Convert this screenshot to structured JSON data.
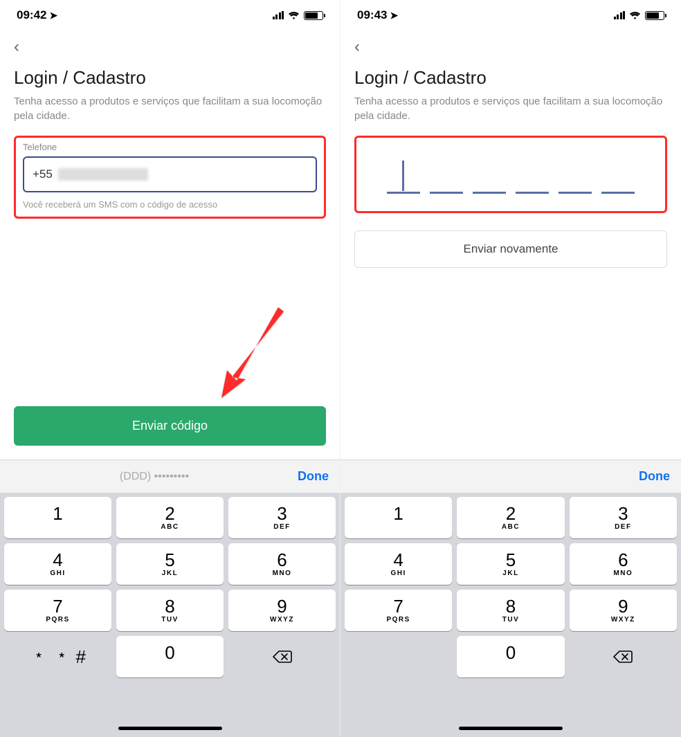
{
  "left": {
    "status": {
      "time": "09:42"
    },
    "header": {
      "back": "‹",
      "title": "Login / Cadastro",
      "subtitle": "Tenha acesso a produtos e serviços que facilitam a sua locomoção pela cidade."
    },
    "phone_field": {
      "label": "Telefone",
      "prefix": "+55",
      "helper": "Você receberá um SMS com o código de acesso"
    },
    "send_button": "Enviar código",
    "keyboard": {
      "placeholder": "(DDD) •••••••••",
      "done": "Done",
      "keys": [
        {
          "n": "1",
          "l": ""
        },
        {
          "n": "2",
          "l": "ABC"
        },
        {
          "n": "3",
          "l": "DEF"
        },
        {
          "n": "4",
          "l": "GHI"
        },
        {
          "n": "5",
          "l": "JKL"
        },
        {
          "n": "6",
          "l": "MNO"
        },
        {
          "n": "7",
          "l": "PQRS"
        },
        {
          "n": "8",
          "l": "TUV"
        },
        {
          "n": "9",
          "l": "WXYZ"
        },
        {
          "n": "﹡  ﹡  #",
          "l": "",
          "special": true
        },
        {
          "n": "0",
          "l": ""
        },
        {
          "n": "del",
          "special": true,
          "backspace": true
        }
      ]
    }
  },
  "right": {
    "status": {
      "time": "09:43"
    },
    "header": {
      "back": "‹",
      "title": "Login / Cadastro",
      "subtitle": "Tenha acesso a produtos e serviços que facilitam a sua locomoção pela cidade."
    },
    "resend_button": "Enviar novamente",
    "keyboard": {
      "done": "Done",
      "keys": [
        {
          "n": "1",
          "l": ""
        },
        {
          "n": "2",
          "l": "ABC"
        },
        {
          "n": "3",
          "l": "DEF"
        },
        {
          "n": "4",
          "l": "GHI"
        },
        {
          "n": "5",
          "l": "JKL"
        },
        {
          "n": "6",
          "l": "MNO"
        },
        {
          "n": "7",
          "l": "PQRS"
        },
        {
          "n": "8",
          "l": "TUV"
        },
        {
          "n": "9",
          "l": "WXYZ"
        },
        {
          "n": "",
          "blank": true
        },
        {
          "n": "0",
          "l": ""
        },
        {
          "n": "del",
          "special": true,
          "backspace": true
        }
      ]
    }
  }
}
